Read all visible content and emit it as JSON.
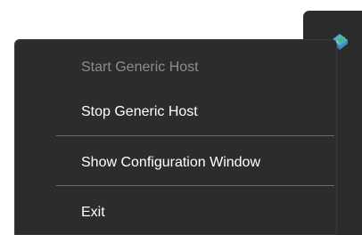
{
  "tray": {
    "app_icon": "generic-host-tray-icon"
  },
  "context_menu": {
    "items": [
      {
        "label": "Start Generic Host",
        "enabled": false
      },
      {
        "label": "Stop Generic Host",
        "enabled": true
      },
      {
        "label": "Show Configuration Window",
        "enabled": true
      },
      {
        "label": "Exit",
        "enabled": true
      }
    ]
  },
  "colors": {
    "menu_background": "#2c2c2c",
    "text": "#ffffff",
    "disabled_text": "#8d8d8d",
    "separator": "#6a6a6a"
  }
}
